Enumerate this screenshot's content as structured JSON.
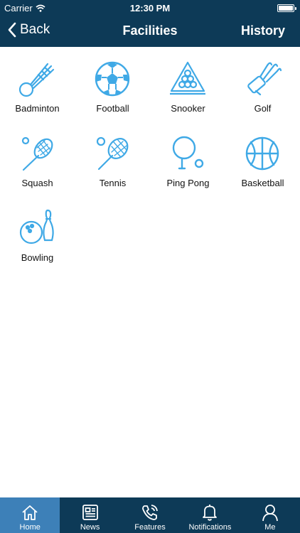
{
  "status_bar": {
    "carrier": "Carrier",
    "time": "12:30 PM"
  },
  "nav": {
    "back_label": "Back",
    "title": "Facilities",
    "history_label": "History"
  },
  "colors": {
    "bar": "#0d3a57",
    "accent": "#3fa9e6",
    "tab_active": "#3d80b8"
  },
  "facilities": [
    {
      "label": "Badminton",
      "icon": "shuttlecock-icon"
    },
    {
      "label": "Football",
      "icon": "football-icon"
    },
    {
      "label": "Snooker",
      "icon": "snooker-rack-icon"
    },
    {
      "label": "Golf",
      "icon": "golf-bag-icon"
    },
    {
      "label": "Squash",
      "icon": "squash-racket-icon"
    },
    {
      "label": "Tennis",
      "icon": "tennis-racket-icon"
    },
    {
      "label": "Ping Pong",
      "icon": "ping-pong-paddle-icon"
    },
    {
      "label": "Basketball",
      "icon": "basketball-icon"
    },
    {
      "label": "Bowling",
      "icon": "bowling-icon"
    }
  ],
  "tabs": [
    {
      "label": "Home",
      "icon": "home-icon",
      "active": true
    },
    {
      "label": "News",
      "icon": "newspaper-icon",
      "active": false
    },
    {
      "label": "Features",
      "icon": "phone-icon",
      "active": false
    },
    {
      "label": "Notifications",
      "icon": "bell-icon",
      "active": false
    },
    {
      "label": "Me",
      "icon": "person-icon",
      "active": false
    }
  ]
}
